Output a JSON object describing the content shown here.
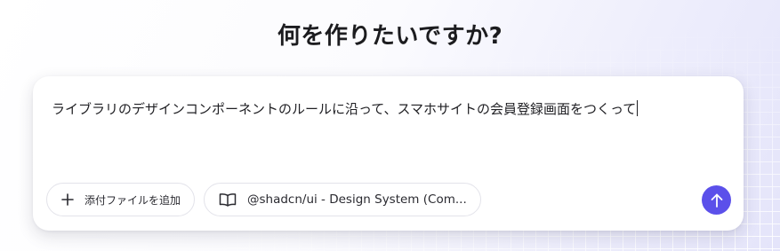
{
  "page": {
    "title": "何を作りたいですか?"
  },
  "prompt": {
    "text": "ライブラリのデザインコンポーネントのルールに沿って、スマホサイトの会員登録画面をつくって"
  },
  "toolbar": {
    "attach_label": "添付ファイルを追加",
    "attach_icon": "plus-icon",
    "design_system_label": "@shadcn/ui - Design System (Com...",
    "design_system_icon": "book-open-icon",
    "send_icon": "arrow-up-icon"
  },
  "colors": {
    "accent": "#5b50ea",
    "text": "#1f1f23",
    "border": "#e3e3ea"
  }
}
